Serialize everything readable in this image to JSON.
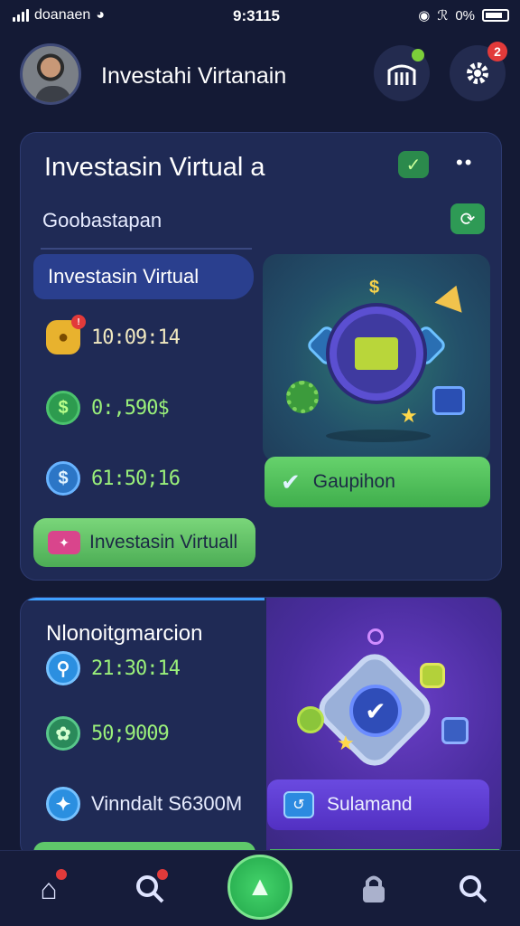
{
  "status_bar": {
    "carrier": "doanaen",
    "time": "9:3115",
    "battery": "0%"
  },
  "header": {
    "title": "Investahi Virtanain",
    "badge_count": "2"
  },
  "card1": {
    "title": "Investasin Virtual a",
    "subtitle": "Goobastapan",
    "tab_label": "Investasin Virtual",
    "stats": [
      {
        "icon": "coin-icon",
        "value": "10:09:14"
      },
      {
        "icon": "dollar-icon",
        "value": "0:,590$"
      },
      {
        "icon": "dollar-icon",
        "value": "61:50;16"
      }
    ],
    "button_label": "Investasin Virtuall",
    "action_label": "Gaupihon"
  },
  "card2": {
    "title": "Nlonoitgmarcion",
    "stats": [
      {
        "icon": "key-icon",
        "value": "21:30:14"
      },
      {
        "icon": "clover-icon",
        "value": "50;9009"
      },
      {
        "icon": "spark-icon",
        "value": "Vinndalt S6300M"
      }
    ],
    "action_label": "Sulamand"
  },
  "colors": {
    "accent_green": "#4cad55",
    "accent_purple": "#5230c2",
    "background": "#141a35"
  }
}
